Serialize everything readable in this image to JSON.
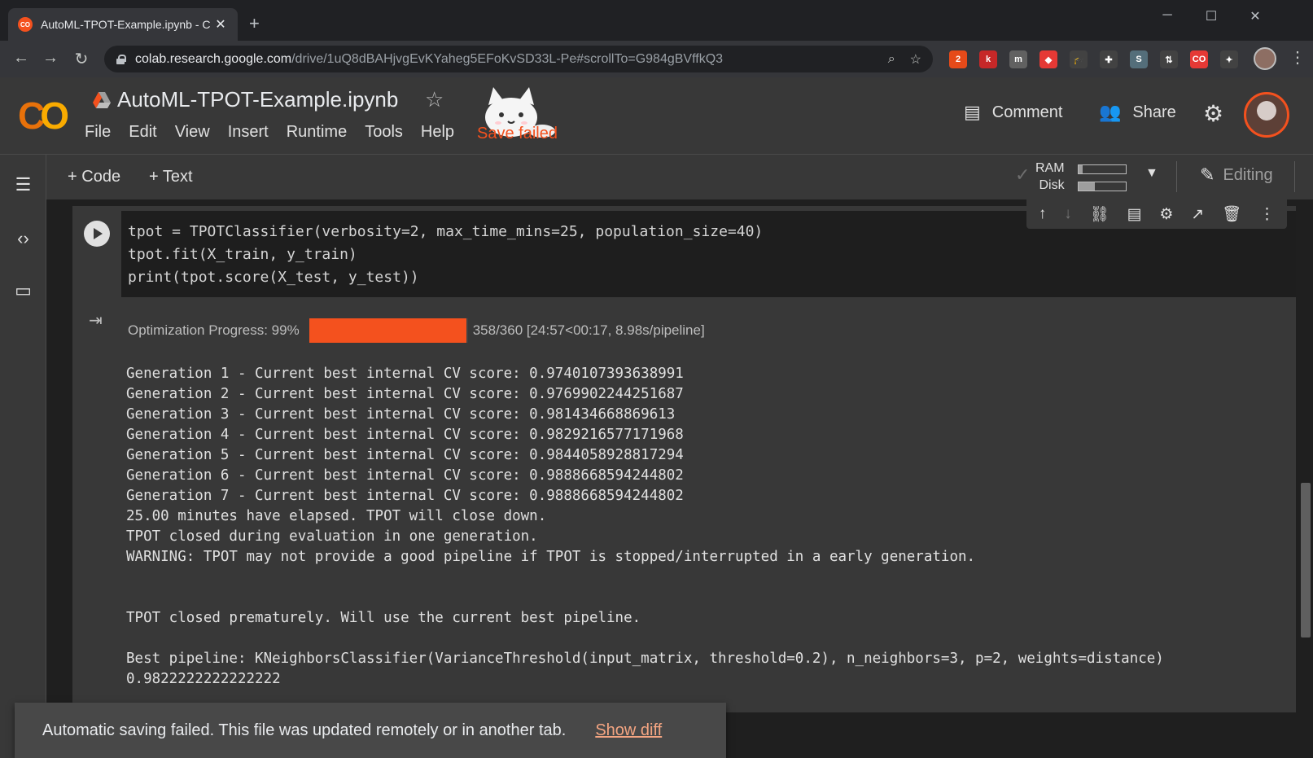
{
  "browser": {
    "tab_title": "AutoML-TPOT-Example.ipynb - C",
    "tab_favicon": "CO",
    "url_host": "colab.research.google.com",
    "url_path": "/drive/1uQ8dBAHjvgEvKYaheg5EFoKvSD33L-Pe#scrollTo=G984gBVffkQ3",
    "new_tab_glyph": "+",
    "close_glyph": "✕",
    "extensions": [
      {
        "label": "2",
        "color": "#e64a19"
      },
      {
        "label": "k",
        "color": "#c62828"
      },
      {
        "label": "m",
        "color": "#616161"
      },
      {
        "label": "◆",
        "color": "#e53935"
      },
      {
        "label": "🎓",
        "color": "#424242"
      },
      {
        "label": "✚",
        "color": "#424242"
      },
      {
        "label": "S",
        "color": "#546e7a"
      },
      {
        "label": "⇅",
        "color": "#424242"
      },
      {
        "label": "CO",
        "color": "#e53935"
      },
      {
        "label": "✦",
        "color": "#424242"
      }
    ]
  },
  "colab": {
    "logo": "CO",
    "notebook_title": "AutoML-TPOT-Example.ipynb",
    "menu": [
      "File",
      "Edit",
      "View",
      "Insert",
      "Runtime",
      "Tools",
      "Help"
    ],
    "save_status": "Save failed",
    "comment_label": "Comment",
    "share_label": "Share"
  },
  "toolbar": {
    "add_code": "Code",
    "add_text": "Text",
    "ram_label": "RAM",
    "disk_label": "Disk",
    "ram_fraction": 0.08,
    "disk_fraction": 0.35,
    "editing_label": "Editing"
  },
  "cell": {
    "code_lines": [
      "tpot = TPOTClassifier(verbosity=2, max_time_mins=25, population_size=40)",
      "tpot.fit(X_train, y_train)",
      "print(tpot.score(X_test, y_test))"
    ],
    "progress_label": "Optimization Progress: 99%",
    "progress_fraction": 0.99,
    "progress_stats": "358/360 [24:57<00:17, 8.98s/pipeline]",
    "output_lines": [
      "Generation 1 - Current best internal CV score: 0.9740107393638991",
      "Generation 2 - Current best internal CV score: 0.9769902244251687",
      "Generation 3 - Current best internal CV score: 0.981434668869613",
      "Generation 4 - Current best internal CV score: 0.9829216577171968",
      "Generation 5 - Current best internal CV score: 0.9844058928817294",
      "Generation 6 - Current best internal CV score: 0.9888668594244802",
      "Generation 7 - Current best internal CV score: 0.9888668594244802",
      "25.00 minutes have elapsed. TPOT will close down.",
      "TPOT closed during evaluation in one generation.",
      "WARNING: TPOT may not provide a good pipeline if TPOT is stopped/interrupted in a early generation.",
      "",
      "",
      "TPOT closed prematurely. Will use the current best pipeline.",
      "",
      "Best pipeline: KNeighborsClassifier(VarianceThreshold(input_matrix, threshold=0.2), n_neighbors=3, p=2, weights=distance)",
      "0.9822222222222222"
    ]
  },
  "snackbar": {
    "message": "Automatic saving failed. This file was updated remotely or in another tab.",
    "action": "Show diff"
  },
  "colors": {
    "accent": "#f4511e",
    "background": "#1f1f1f",
    "surface": "#383838"
  }
}
